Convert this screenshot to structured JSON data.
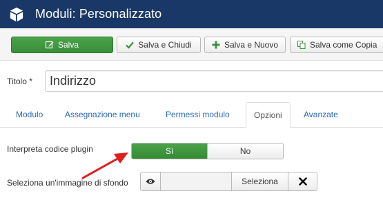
{
  "header": {
    "title": "Moduli: Personalizzato",
    "icon": "cube-icon"
  },
  "toolbar": {
    "save_label": "Salva",
    "save_close_label": "Salva e Chiudi",
    "save_new_label": "Salva e Nuovo",
    "save_copy_label": "Salva come Copia"
  },
  "form": {
    "title_label": "Titolo *",
    "title_value": "Indirizzo"
  },
  "tabs": [
    {
      "label": "Modulo",
      "active": false
    },
    {
      "label": "Assegnazione menu",
      "active": false
    },
    {
      "label": "Permessi modulo",
      "active": false
    },
    {
      "label": "Opzioni",
      "active": true
    },
    {
      "label": "Avanzate",
      "active": false
    }
  ],
  "options": {
    "plugin_label": "Interpreta codice plugin",
    "plugin_yes": "Sì",
    "plugin_no": "No",
    "plugin_value": "Sì",
    "image_label": "Seleziona un'immagine di sfondo",
    "select_button": "Seleziona"
  },
  "colors": {
    "header_bg": "#1a3867",
    "success": "#46a546",
    "link": "#2a69b8",
    "annotation_arrow": "#e01e1e"
  }
}
